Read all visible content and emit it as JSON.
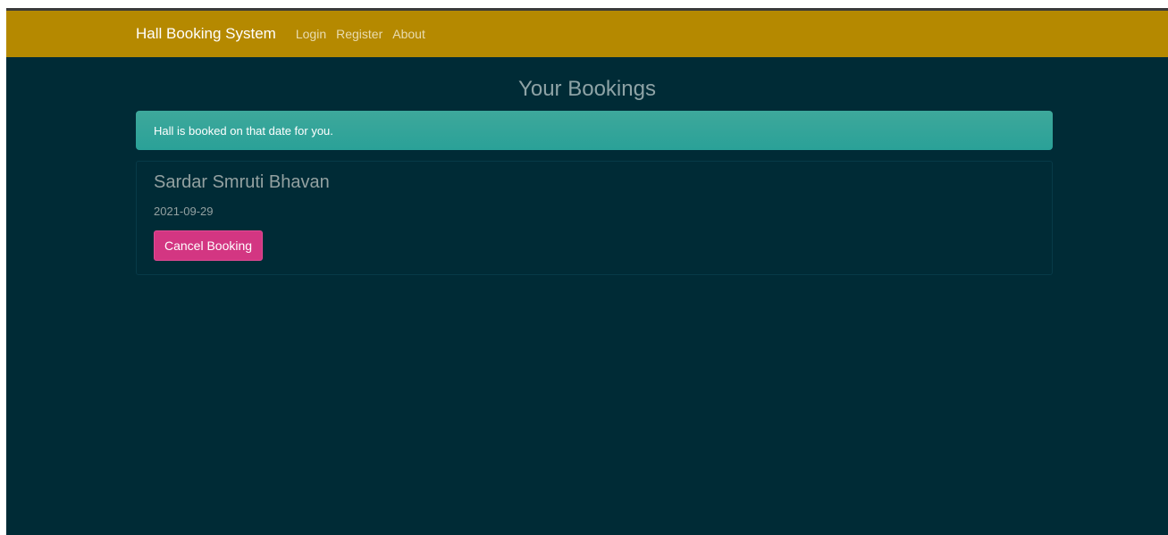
{
  "navbar": {
    "brand": "Hall Booking System",
    "links": [
      "Login",
      "Register",
      "About"
    ]
  },
  "main": {
    "title": "Your Bookings",
    "alert": "Hall is booked on that date for you.",
    "bookings": [
      {
        "hall_name": "Sardar Smruti Bhavan",
        "date": "2021-09-29",
        "cancel_label": "Cancel Booking"
      }
    ]
  },
  "colors": {
    "navbar": "#b58900",
    "background": "#002b36",
    "alert": "#2aa198",
    "cancel_button": "#d33682"
  }
}
